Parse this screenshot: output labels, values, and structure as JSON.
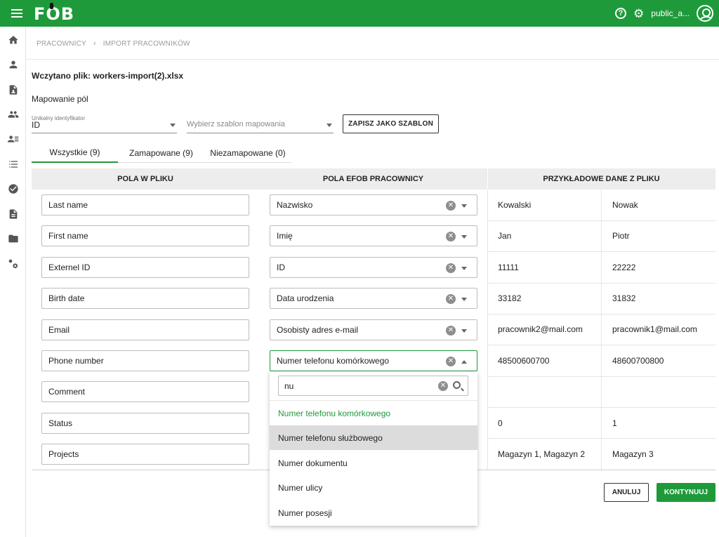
{
  "app": {
    "logo": "FOB",
    "user": "public_a..."
  },
  "breadcrumb": [
    "PRACOWNICY",
    "IMPORT PRACOWNIKÓW"
  ],
  "file_title": "Wczytano plik: workers-import(2).xlsx",
  "mapping_label": "Mapowanie pól",
  "identifier": {
    "label": "Unikalny identyfikator",
    "value": "ID"
  },
  "template": {
    "placeholder": "Wybierz szablon mapowania"
  },
  "save_template_label": "ZAPISZ JAKO SZABLON",
  "tabs": [
    {
      "label": "Wszystkie (9)",
      "active": true
    },
    {
      "label": "Zamapowane (9)",
      "active": false
    },
    {
      "label": "Niezamapowane (0)",
      "active": false
    }
  ],
  "table": {
    "headers": [
      "POLA W PLIKU",
      "POLA EFOB PRACOWNICY",
      "PRZYKŁADOWE DANE Z PLIKU"
    ],
    "rows": [
      {
        "file_field": "Last name",
        "mapped": "Nazwisko",
        "sample1": "Kowalski",
        "sample2": "Nowak"
      },
      {
        "file_field": "First name",
        "mapped": "Imię",
        "sample1": "Jan",
        "sample2": "Piotr"
      },
      {
        "file_field": "Externel ID",
        "mapped": "ID",
        "sample1": "11111",
        "sample2": "22222"
      },
      {
        "file_field": "Birth date",
        "mapped": "Data urodzenia",
        "sample1": "33182",
        "sample2": "31832"
      },
      {
        "file_field": "Email",
        "mapped": "Osobisty adres e-mail",
        "sample1": "pracownik2@mail.com",
        "sample2": "pracownik1@mail.com"
      },
      {
        "file_field": "Phone number",
        "mapped": "Numer telefonu komórkowego",
        "sample1": "48500600700",
        "sample2": "48600700800"
      },
      {
        "file_field": "Comment",
        "mapped": "",
        "sample1": "",
        "sample2": ""
      },
      {
        "file_field": "Status",
        "mapped": "",
        "sample1": "0",
        "sample2": "1"
      },
      {
        "file_field": "Projects",
        "mapped": "",
        "sample1": "Magazyn 1, Magazyn 2",
        "sample2": "Magazyn 3"
      }
    ]
  },
  "dropdown": {
    "search_value": "nu",
    "options": [
      "Numer telefonu komórkowego",
      "Numer telefonu służbowego",
      "Numer dokumentu",
      "Numer ulicy",
      "Numer posesji"
    ],
    "selected_index": 0,
    "hover_index": 1
  },
  "actions": {
    "cancel": "ANULUJ",
    "continue": "KONTYNUUJ"
  },
  "colors": {
    "brand": "#1f9a3b",
    "header_bg": "#ededed"
  }
}
